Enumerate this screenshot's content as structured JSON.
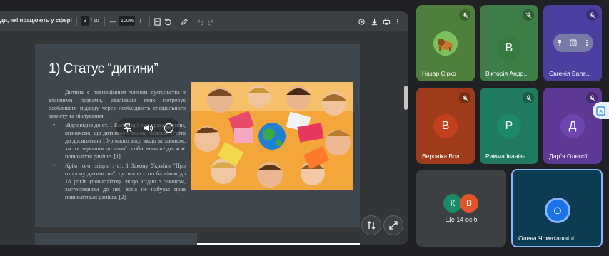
{
  "toolbar": {
    "doc_title": "ди, які працюють у сфері охор...",
    "page_current": "3",
    "page_total": "/ 10",
    "zoom_out": "—",
    "zoom": "100%",
    "zoom_in": "+"
  },
  "slide": {
    "title": "1)  Статус “дитини”",
    "intro": "Дитина є повноцінним членом суспільства з власними правами, реалізація яких потребує особливого підходу через необхідність спеціального захисту та піклування.",
    "bullets": [
      "Відповідно до ст. 1 Конвенції про права дитини, визначено, що дитиною є кожна людська істота до досягнення 18-річного віку, якщо за законом, застосовуваним до даної особи, вона не досягає повноліття раніше. [1]",
      "Крім того, згідно з ст. 1 Закону України \"Про охорону дитинства\", дитиною є особа віком до 18 років (повноліття), якщо згідно з законом, застосованим до неї, вона не набуває прав повнолітньої раніше. [2]"
    ]
  },
  "participants": [
    {
      "name": "Назар Сірко",
      "initial": "",
      "bg": "#4f7f3c",
      "mic_muted": true
    },
    {
      "name": "Вікторія Андр...",
      "initial": "В",
      "bg": "#3e7c48",
      "avatar_bg": "#357a3f",
      "mic_muted": true
    },
    {
      "name": "Євгенія Вале...",
      "initial": "",
      "bg": "#4b3fa0",
      "mic_muted": true
    },
    {
      "name": "Вероніка Вол...",
      "initial": "В",
      "bg": "#9e3b1b",
      "avatar_bg": "#c4401c",
      "mic_muted": true
    },
    {
      "name": "Римма Іванівн...",
      "initial": "Р",
      "bg": "#1f7a5f",
      "avatar_bg": "#1a8a68",
      "mic_muted": true
    },
    {
      "name": "Дар`я Олексії...",
      "initial": "Д",
      "bg": "#5c3a96",
      "avatar_bg": "#6d44b0",
      "mic_muted": true
    }
  ],
  "more": {
    "label": "Ще 14 осіб",
    "initials": [
      "К",
      "В"
    ]
  },
  "self_tile": {
    "name": "Олена Чомахашвілі",
    "initial": "О"
  },
  "colors": {
    "accent": "#8ab4f8",
    "viewer_bg": "#323639",
    "toolbar_bg": "#3c4043"
  }
}
